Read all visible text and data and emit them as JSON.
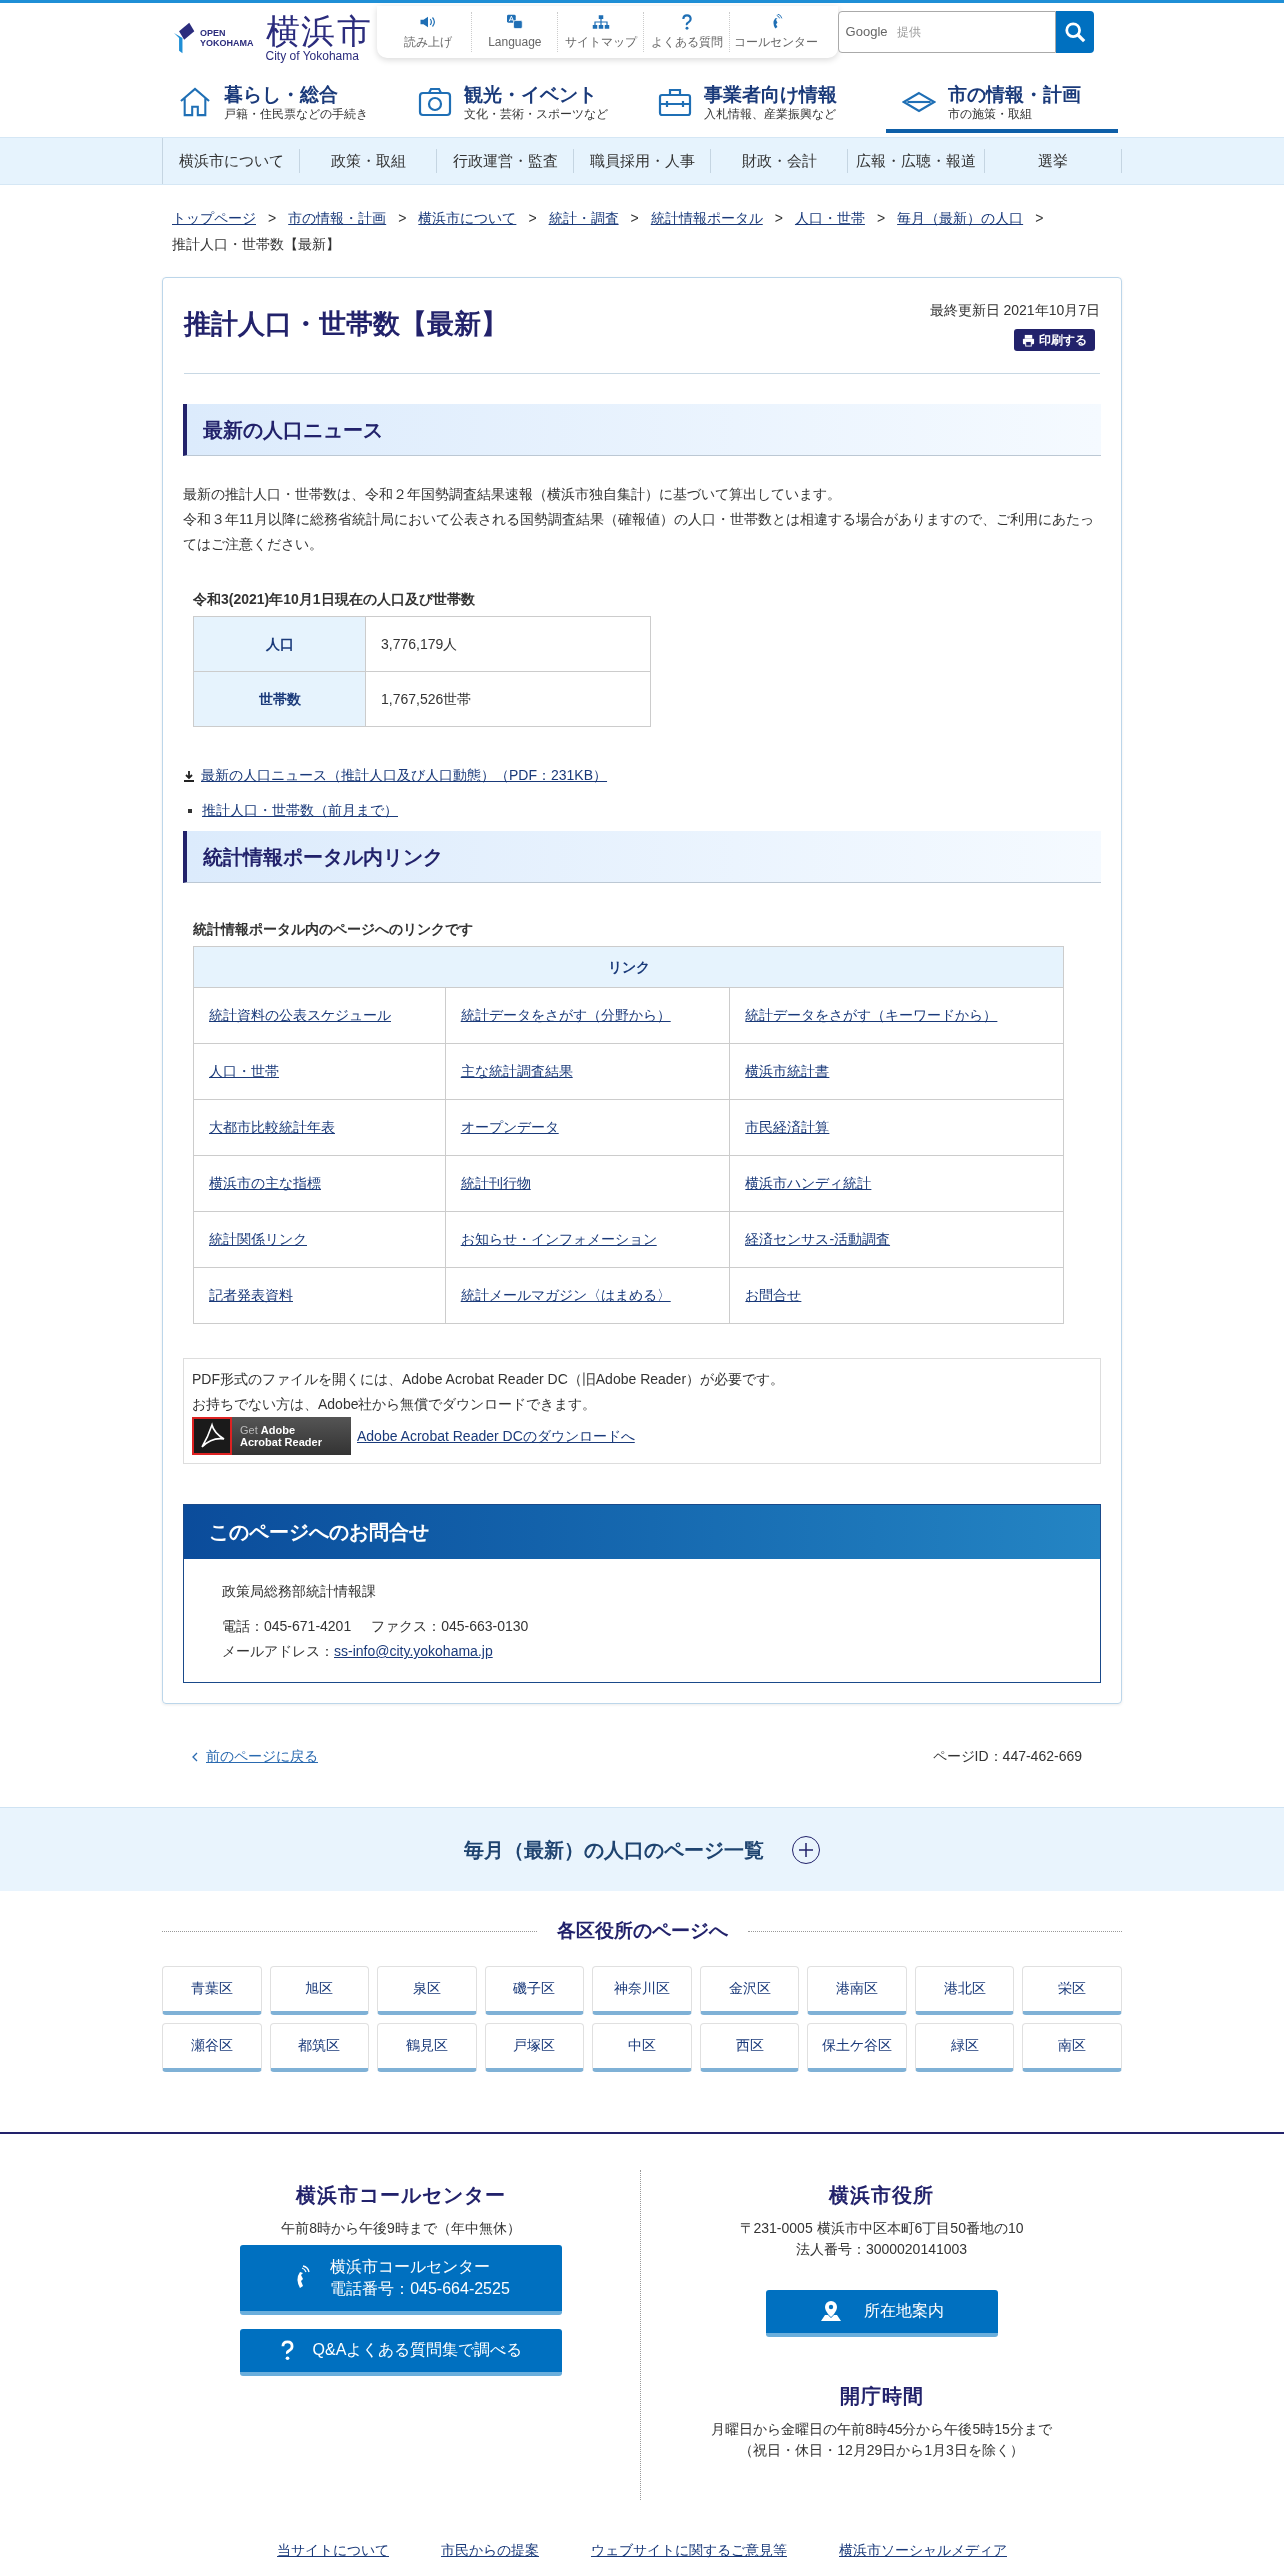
{
  "header": {
    "logo_mark": [
      "OPEN",
      "YOKOHAMA"
    ],
    "logo_text": "横浜市",
    "logo_subtitle": "City of Yokohama",
    "utility_links": [
      {
        "label": "読み上げ",
        "kind": "speaker"
      },
      {
        "label": "Language",
        "kind": "language"
      },
      {
        "label": "サイトマップ",
        "kind": "sitemap"
      },
      {
        "label": "よくある質問",
        "kind": "question"
      },
      {
        "label": "コールセンター",
        "kind": "phone"
      }
    ],
    "search": {
      "brand": "Google",
      "placeholder": "提供"
    }
  },
  "main_nav": [
    {
      "title": "暮らし・総合",
      "subtitle": "戸籍・住民票などの手続き",
      "kind": "house",
      "selected": false
    },
    {
      "title": "観光・イベント",
      "subtitle": "文化・芸術・スポーツなど",
      "kind": "camera",
      "selected": false
    },
    {
      "title": "事業者向け情報",
      "subtitle": "入札情報、産業振興など",
      "kind": "toolbox",
      "selected": false
    },
    {
      "title": "市の情報・計画",
      "subtitle": "市の施策・取組",
      "kind": "diamond",
      "selected": true
    }
  ],
  "sub_nav": [
    "横浜市について",
    "政策・取組",
    "行政運営・監査",
    "職員採用・人事",
    "財政・会計",
    "広報・広聴・報道",
    "選挙"
  ],
  "breadcrumb": {
    "links": [
      "トップページ",
      "市の情報・計画",
      "横浜市について",
      "統計・調査",
      "統計情報ポータル",
      "人口・世帯",
      "毎月（最新）の人口"
    ],
    "separator": ">",
    "current": "推計人口・世帯数【最新】"
  },
  "page": {
    "title": "推計人口・世帯数【最新】",
    "updated": "最終更新日 2021年10月7日",
    "print_button": "印刷する",
    "news": {
      "heading": "最新の人口ニュース",
      "paragraphs": [
        "最新の推計人口・世帯数は、令和２年国勢調査結果速報（横浜市独自集計）に基づいて算出しています。",
        "令和３年11月以降に総務省統計局において公表される国勢調査結果（確報値）の人口・世帯数とは相違する場合がありますので、ご利用にあたってはご注意ください。"
      ],
      "table": {
        "caption": "令和3(2021)年10月1日現在の人口及び世帯数",
        "rows": [
          {
            "label": "人口",
            "value": "3,776,179人"
          },
          {
            "label": "世帯数",
            "value": "1,767,526世帯"
          }
        ]
      },
      "download_link": "最新の人口ニュース（推計人口及び人口動態）（PDF：231KB）",
      "list_links": [
        "推計人口・世帯数（前月まで）"
      ]
    },
    "portal": {
      "heading": "統計情報ポータル内リンク",
      "caption": "統計情報ポータル内のページへのリンクです",
      "table_header": "リンク",
      "rows": [
        [
          "統計資料の公表スケジュール",
          "統計データをさがす（分野から）",
          "統計データをさがす（キーワードから）"
        ],
        [
          "人口・世帯",
          "主な統計調査結果",
          "横浜市統計書"
        ],
        [
          "大都市比較統計年表",
          "オープンデータ",
          "市民経済計算"
        ],
        [
          "横浜市の主な指標",
          "統計刊行物",
          "横浜市ハンディ統計"
        ],
        [
          "統計関係リンク",
          "お知らせ・インフォメーション",
          "経済センサス-活動調査"
        ],
        [
          "記者発表資料",
          "統計メールマガジン〈はまめる〉",
          "お問合せ"
        ]
      ]
    },
    "pdf_note": {
      "lines": [
        "PDF形式のファイルを開くには、Adobe Acrobat Reader DC（旧Adobe Reader）が必要です。",
        "お持ちでない方は、Adobe社から無償でダウンロードできます。"
      ],
      "badge": [
        "Get",
        "Adobe",
        "Acrobat Reader"
      ],
      "link": "Adobe Acrobat Reader DCのダウンロードへ"
    },
    "contact": {
      "heading": "このページへのお問合せ",
      "department": "政策局総務部統計情報課",
      "phone": "電話：045-671-4201",
      "fax": "ファクス：045-663-0130",
      "mail_label": "メールアドレス：",
      "mail": "ss-info@city.yokohama.jp"
    }
  },
  "page_footer": {
    "back_link": "前のページに戻る",
    "page_id": "ページID：447-462-669"
  },
  "accordion": {
    "title": "毎月（最新）の人口のページ一覧",
    "expanded": false
  },
  "wards": {
    "heading": "各区役所のページへ",
    "items": [
      "青葉区",
      "旭区",
      "泉区",
      "磯子区",
      "神奈川区",
      "金沢区",
      "港南区",
      "港北区",
      "栄区",
      "瀬谷区",
      "都筑区",
      "鶴見区",
      "戸塚区",
      "中区",
      "西区",
      "保土ケ谷区",
      "緑区",
      "南区"
    ]
  },
  "footer": {
    "call_center": {
      "heading": "横浜市コールセンター",
      "hours": "午前8時から午後9時まで（年中無休）",
      "phone_button": [
        "横浜市コールセンター",
        "電話番号：045-664-2525"
      ],
      "faq_button": "Q&Aよくある質問集で調べる"
    },
    "city_hall": {
      "heading": "横浜市役所",
      "address": "〒231-0005 横浜市中区本町6丁目50番地の10",
      "corporate_number": "法人番号：3000020141003",
      "map_button": "所在地案内",
      "hours_heading": "開庁時間",
      "hours": [
        "月曜日から金曜日の午前8時45分から午後5時15分まで",
        "（祝日・休日・12月29日から1月3日を除く）"
      ]
    },
    "links": [
      "当サイトについて",
      "市民からの提案",
      "ウェブサイトに関するご意見等",
      "横浜市ソーシャルメディア"
    ]
  }
}
